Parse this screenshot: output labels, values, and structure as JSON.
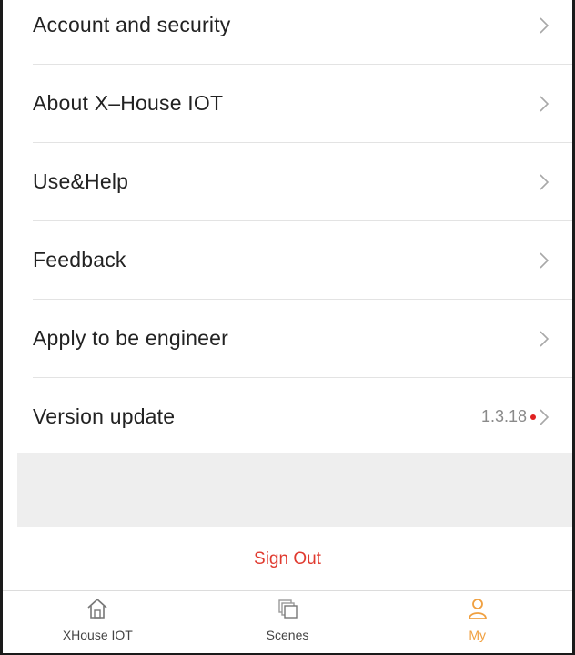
{
  "menu": {
    "items": [
      {
        "label": "Account and security"
      },
      {
        "label": "About X–House IOT"
      },
      {
        "label": "Use&Help"
      },
      {
        "label": "Feedback"
      },
      {
        "label": "Apply to be engineer"
      },
      {
        "label": "Version update",
        "value": "1.3.18"
      }
    ]
  },
  "sign_out": {
    "label": "Sign Out",
    "color": "#e03a2f"
  },
  "tabbar": {
    "tabs": [
      {
        "label": "XHouse IOT",
        "icon": "home-icon"
      },
      {
        "label": "Scenes",
        "icon": "scenes-icon"
      },
      {
        "label": "My",
        "icon": "user-icon",
        "active": true
      }
    ],
    "active_color": "#f0a040"
  }
}
